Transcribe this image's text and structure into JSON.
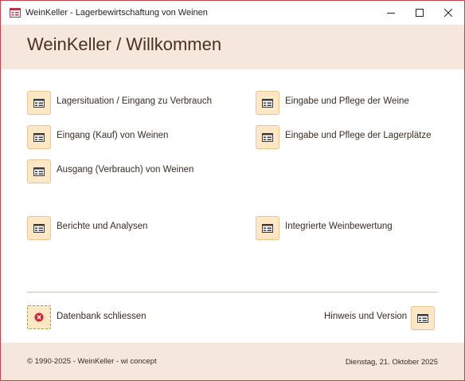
{
  "window": {
    "title": "WeinKeller - Lagerbewirtschaftung von Weinen"
  },
  "header": {
    "title": "WeinKeller / Willkommen"
  },
  "menu": {
    "lagersituation": "Lagersituation / Eingang zu Verbrauch",
    "eingang_kauf": "Eingang (Kauf) von Weinen",
    "ausgang_verbrauch": "Ausgang (Verbrauch) von Weinen",
    "berichte": "Berichte und Analysen",
    "pflege_weine": "Eingabe und Pflege der Weine",
    "pflege_lagerplaetze": "Eingabe und Pflege der Lagerplätze",
    "weinbewertung": "Integrierte Weinbewertung"
  },
  "actions": {
    "close_db": "Datenbank schliessen",
    "info_version": "Hinweis und Version"
  },
  "footer": {
    "copyright": "© 1990-2025 - WeinKeller - wi concept",
    "date": "Dienstag, 21. Oktober 2025"
  },
  "colors": {
    "accent_band": "#f5e7dc",
    "button_fill": "#fde7c4",
    "window_border": "#c1444d",
    "close_icon": "#d4242b"
  },
  "icons": {
    "form": "form-icon",
    "close": "close-circle-icon",
    "app": "app-form-icon"
  }
}
